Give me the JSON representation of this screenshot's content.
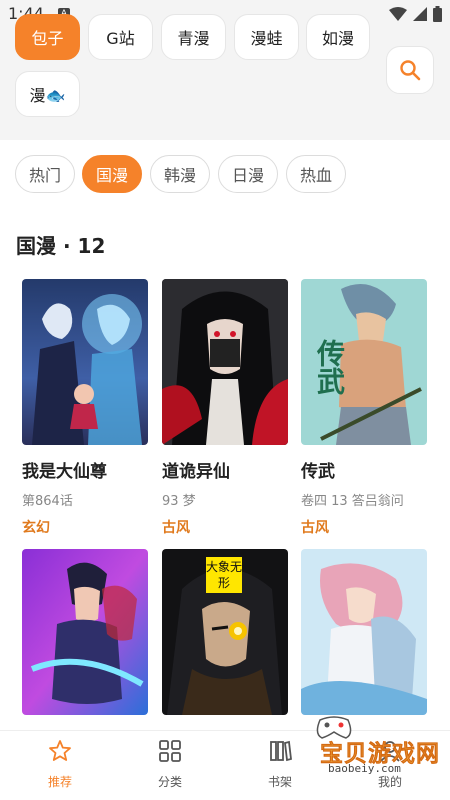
{
  "status": {
    "time": "1:44",
    "notif_badge": "A"
  },
  "sources": [
    "包子",
    "G站",
    "青漫",
    "漫蛙",
    "如漫",
    "漫🐟"
  ],
  "sources_active": "包子",
  "categories": [
    "热门",
    "国漫",
    "韩漫",
    "日漫",
    "热血"
  ],
  "category_active": "国漫",
  "section": {
    "title": "国漫 · 12"
  },
  "comics": [
    {
      "title": "我是大仙尊",
      "sub": "第864话",
      "tag": "玄幻"
    },
    {
      "title": "道诡异仙",
      "sub": "93 梦",
      "tag": "古风"
    },
    {
      "title": "传武",
      "sub": "卷四 13 答吕翁问",
      "tag": "古风"
    },
    {
      "title": "",
      "sub": "",
      "tag": ""
    },
    {
      "title": "",
      "sub": "",
      "tag": ""
    },
    {
      "title": "",
      "sub": "",
      "tag": ""
    }
  ],
  "cover_text": {
    "c2": "大象无形",
    "c3": "传武"
  },
  "tabbar": {
    "items": [
      {
        "label": "推荐",
        "icon": "star-icon",
        "active": true
      },
      {
        "label": "分类",
        "icon": "grid-icon",
        "active": false
      },
      {
        "label": "书架",
        "icon": "bookshelf-icon",
        "active": false
      },
      {
        "label": "我的",
        "icon": "profile-icon",
        "active": false
      }
    ]
  },
  "watermark": {
    "text": "宝贝游戏网",
    "url": "baobeiy.com"
  },
  "colors": {
    "accent": "#f5822a",
    "tag": "#e07a1e",
    "background_top": "#f4f4f4"
  }
}
